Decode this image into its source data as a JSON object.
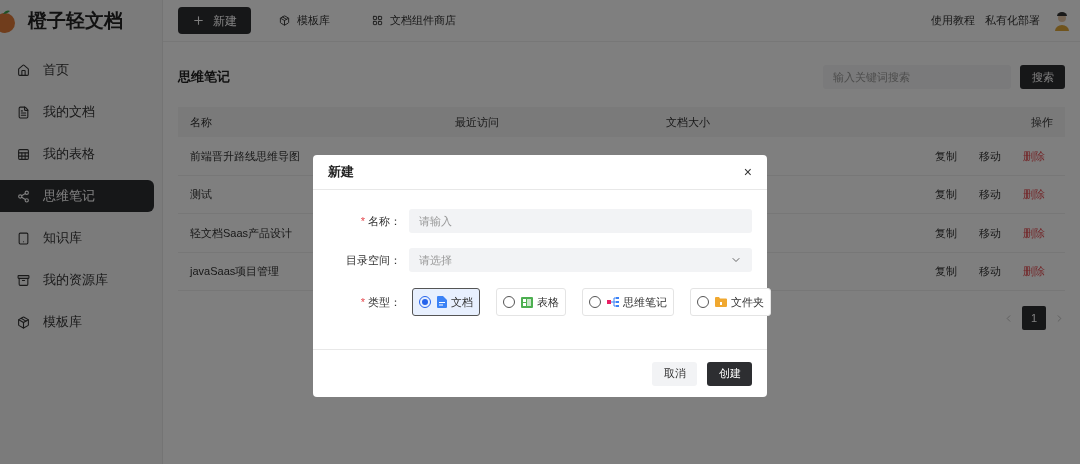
{
  "app": {
    "name": "橙子轻文档"
  },
  "header": {
    "new_button": "新建",
    "nav": [
      "模板库",
      "文档组件商店"
    ],
    "links": [
      "使用教程",
      "私有化部署"
    ]
  },
  "sidebar": {
    "items": [
      {
        "label": "首页",
        "selected": false
      },
      {
        "label": "我的文档",
        "selected": false
      },
      {
        "label": "我的表格",
        "selected": false
      },
      {
        "label": "思维笔记",
        "selected": true
      },
      {
        "label": "知识库",
        "selected": false
      },
      {
        "label": "我的资源库",
        "selected": false
      },
      {
        "label": "模板库",
        "selected": false
      }
    ]
  },
  "main": {
    "title": "思维笔记",
    "search": {
      "placeholder": "输入关键词搜索",
      "button": "搜索"
    },
    "table": {
      "columns": [
        "名称",
        "最近访问",
        "文档大小",
        "操作"
      ],
      "rows": [
        {
          "name": "前端晋升路线思维导图",
          "actions": [
            "复制",
            "移动",
            "删除"
          ]
        },
        {
          "name": "测试",
          "actions": [
            "复制",
            "移动",
            "删除"
          ]
        },
        {
          "name": "轻文档Saas产品设计",
          "actions": [
            "复制",
            "移动",
            "删除"
          ]
        },
        {
          "name": "javaSaas项目管理",
          "actions": [
            "复制",
            "移动",
            "删除"
          ]
        }
      ]
    },
    "pagination": {
      "pages": [
        {
          "label": "1",
          "selected": true
        }
      ]
    }
  },
  "dialog": {
    "title": "新建",
    "close": "×",
    "fields": [
      {
        "label": "名称：",
        "required": true,
        "kind": "input",
        "placeholder": "请输入"
      },
      {
        "label": "目录空间：",
        "required": false,
        "kind": "select",
        "placeholder": "请选择"
      }
    ],
    "required_mark": "*",
    "type_field": {
      "label": "类型：",
      "required": true,
      "options": [
        {
          "label": "文档",
          "kind": "doc",
          "selected": true
        },
        {
          "label": "表格",
          "kind": "sheet",
          "selected": false
        },
        {
          "label": "思维笔记",
          "kind": "mind",
          "selected": false
        },
        {
          "label": "文件夹",
          "kind": "folder",
          "selected": false
        }
      ]
    },
    "buttons": [
      {
        "label": "取消",
        "kind": "secondary"
      },
      {
        "label": "创建",
        "kind": "primary"
      }
    ]
  }
}
